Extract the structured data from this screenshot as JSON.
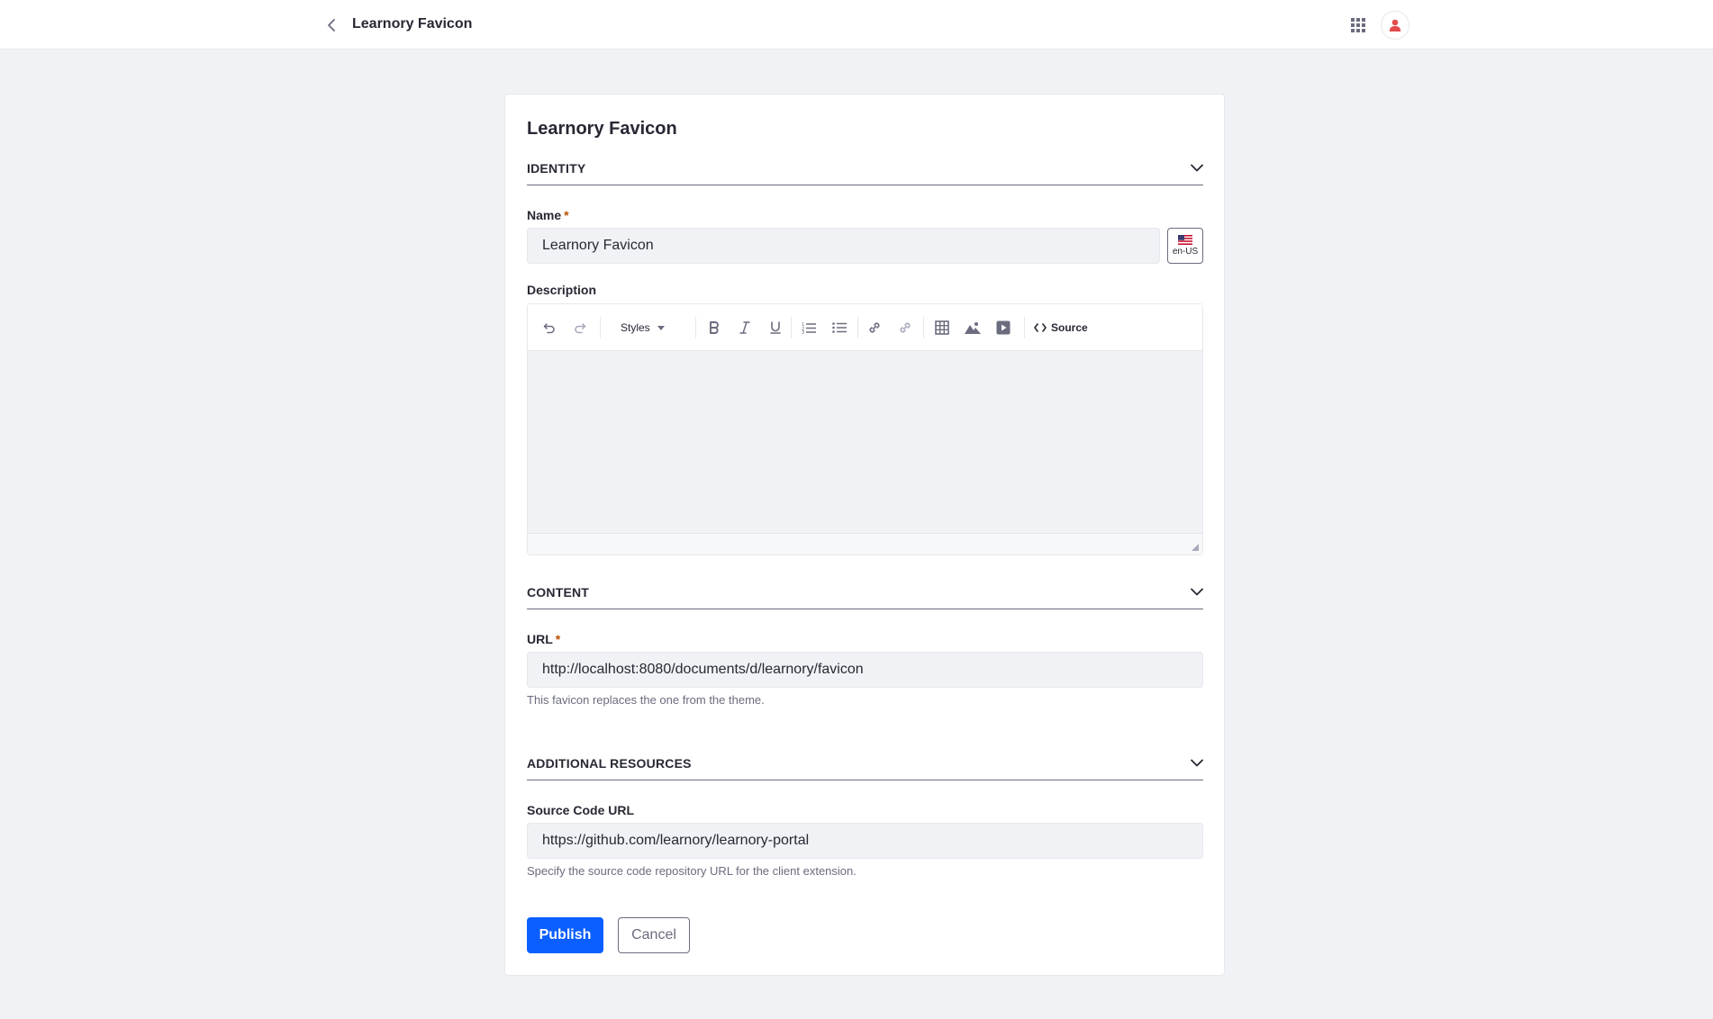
{
  "header": {
    "title": "Learnory Favicon",
    "back_icon": "chevron-left-icon",
    "apps_icon": "grid-icon",
    "user_icon": "user-icon"
  },
  "form": {
    "title": "Learnory Favicon",
    "sections": {
      "identity": {
        "label": "IDENTITY"
      },
      "content": {
        "label": "CONTENT"
      },
      "additional": {
        "label": "ADDITIONAL RESOURCES"
      }
    },
    "name": {
      "label": "Name",
      "required_mark": "*",
      "value": "Learnory Favicon",
      "locale": "en-US"
    },
    "description": {
      "label": "Description",
      "toolbar": {
        "styles_label": "Styles",
        "source_label": "Source"
      }
    },
    "url": {
      "label": "URL",
      "required_mark": "*",
      "value": "http://localhost:8080/documents/d/learnory/favicon",
      "help": "This favicon replaces the one from the theme."
    },
    "source_code_url": {
      "label": "Source Code URL",
      "value": "https://github.com/learnory/learnory-portal",
      "help": "Specify the source code repository URL for the client extension."
    },
    "actions": {
      "publish": "Publish",
      "cancel": "Cancel"
    }
  },
  "colors": {
    "primary": "#0b5fff",
    "required": "#b95000",
    "avatar": "#e34b4b"
  }
}
